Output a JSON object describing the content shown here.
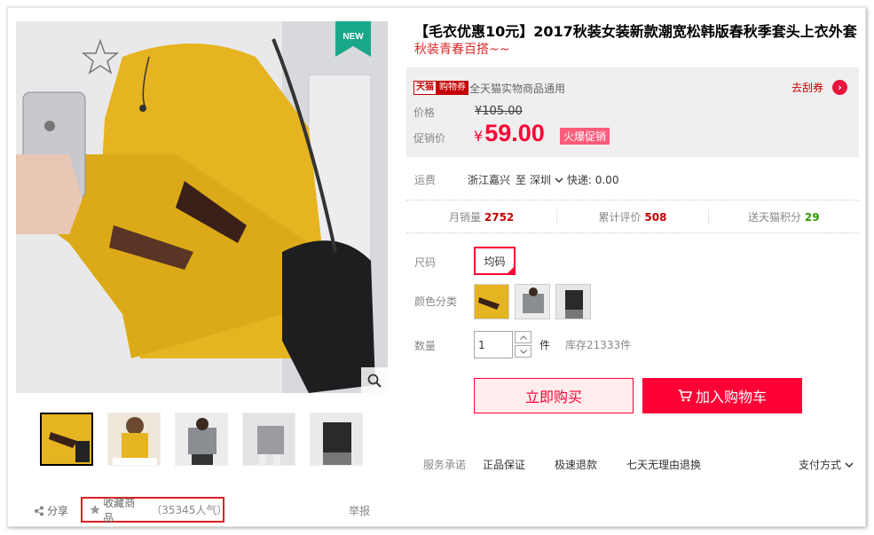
{
  "product": {
    "title": "【毛衣优惠10元】2017秋装女装新款潮宽松韩版春秋季套头上衣外套",
    "subtitle": "秋装青春百搭~~",
    "new_tag": "NEW"
  },
  "coupon": {
    "badge_brand": "天猫",
    "badge_label": "购物券",
    "text": "全天猫实物商品通用",
    "link": "去刮券",
    "link_icon": "chevron-right-icon"
  },
  "price": {
    "label": "价格",
    "original": "¥105.00",
    "promo_label": "促销价",
    "currency": "¥",
    "promo": "59.00",
    "hot_tag": "火爆促销"
  },
  "shipping": {
    "label": "运费",
    "from": "浙江嘉兴",
    "to_word": "至",
    "city": "深圳",
    "fee": "快递: 0.00"
  },
  "stats": [
    {
      "label": "月销量",
      "value": "2752"
    },
    {
      "label": "累计评价",
      "value": "508"
    },
    {
      "label": "送天猫积分",
      "value": "29"
    }
  ],
  "options": {
    "size_label": "尺码",
    "size_value": "均码",
    "color_label": "颜色分类",
    "qty_label": "数量",
    "qty_value": "1",
    "qty_unit": "件",
    "stock": "库存21333件"
  },
  "buttons": {
    "buy": "立即购买",
    "cart": "加入购物车"
  },
  "services": {
    "label": "服务承诺",
    "items": [
      "正品保证",
      "极速退款",
      "七天无理由退换"
    ],
    "pay": "支付方式"
  },
  "actions": {
    "share": "分享",
    "favorite": "收藏商品",
    "favorite_count": "（35345人气）",
    "report": "举报"
  },
  "colors": {
    "accent": "#ff0036",
    "sweater": "#e6b420",
    "highlight_box": "#e02020"
  }
}
